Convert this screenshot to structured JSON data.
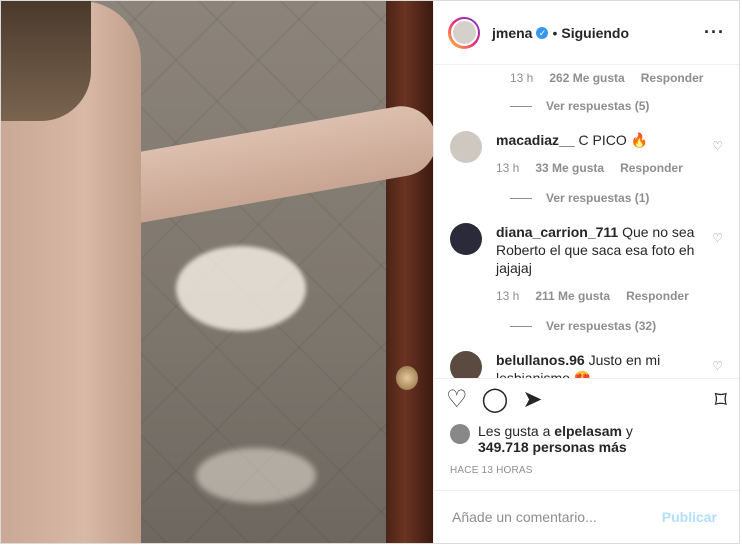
{
  "header": {
    "username": "jmena",
    "following_label": "Siguiendo"
  },
  "top_comment_meta": {
    "time": "13 h",
    "likes": "262 Me gusta",
    "reply": "Responder",
    "view_replies": "Ver respuestas (5)"
  },
  "comments": [
    {
      "user": "macadiaz__",
      "text": "C PICO 🔥",
      "time": "13 h",
      "likes": "33 Me gusta",
      "reply": "Responder",
      "view_replies": "Ver respuestas (1)"
    },
    {
      "user": "diana_carrion_711",
      "text": "Que no sea Roberto el que saca esa foto eh jajajaj",
      "time": "13 h",
      "likes": "211 Me gusta",
      "reply": "Responder",
      "view_replies": "Ver respuestas (32)"
    },
    {
      "user": "belullanos.96",
      "text": "Justo en mi lesbianismo 😍"
    }
  ],
  "likes": {
    "prefix": "Les gusta a",
    "user": "elpelasam",
    "and": "y",
    "others": "349.718 personas más"
  },
  "timestamp": "HACE 13 HORAS",
  "add_comment": {
    "placeholder": "Añade un comentario...",
    "publish": "Publicar"
  },
  "colors": {
    "link_blue": "#3897f0",
    "publish_disabled": "#b2dffc",
    "muted": "#8e8e8e"
  }
}
